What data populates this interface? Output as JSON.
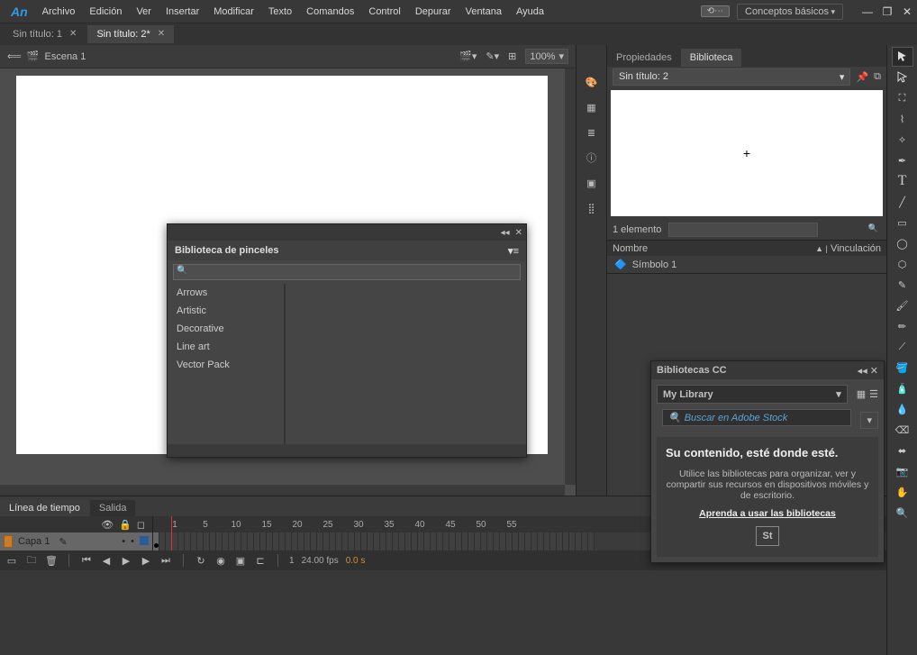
{
  "app": {
    "logo": "An"
  },
  "menu": [
    "Archivo",
    "Edición",
    "Ver",
    "Insertar",
    "Modificar",
    "Texto",
    "Comandos",
    "Control",
    "Depurar",
    "Ventana",
    "Ayuda"
  ],
  "workspace": "Conceptos básicos",
  "tabs": [
    {
      "label": "Sin título: 1",
      "active": false
    },
    {
      "label": "Sin título: 2*",
      "active": true
    }
  ],
  "scene": {
    "name": "Escena 1",
    "zoom": "100%"
  },
  "brush_panel": {
    "title": "Biblioteca de pinceles",
    "search_placeholder": "",
    "categories": [
      "Arrows",
      "Artistic",
      "Decorative",
      "Line art",
      "Vector Pack"
    ]
  },
  "timeline": {
    "tabs": [
      "Línea de tiempo",
      "Salida"
    ],
    "layer": "Capa 1",
    "ruler": [
      "1",
      "5",
      "10",
      "15",
      "20",
      "25",
      "30",
      "35",
      "40",
      "45",
      "50",
      "55"
    ],
    "status": {
      "frame": "1",
      "fps": "24.00 fps",
      "time": "0.0 s"
    }
  },
  "right": {
    "tabs": [
      "Propiedades",
      "Biblioteca"
    ],
    "doc": "Sin título: 2",
    "count": "1 elemento",
    "cols": {
      "name": "Nombre",
      "link": "Vinculación"
    },
    "item": "Símbolo 1"
  },
  "cc": {
    "title": "Bibliotecas CC",
    "library": "My Library",
    "search_placeholder": "Buscar en Adobe Stock",
    "heading": "Su contenido, esté donde esté.",
    "body": "Utilice las bibliotecas para organizar, ver y compartir sus recursos en dispositivos móviles y de escritorio.",
    "link": "Aprenda a usar las bibliotecas",
    "stock": "St"
  }
}
